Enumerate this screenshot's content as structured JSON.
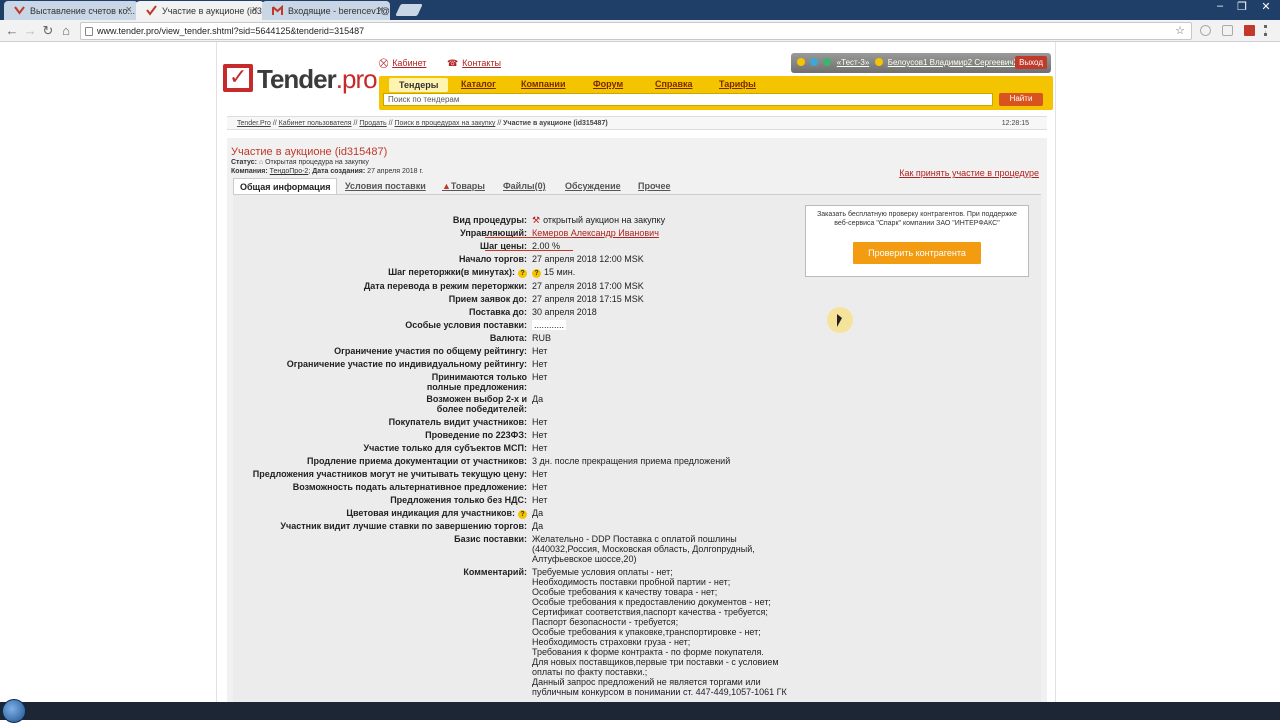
{
  "browser": {
    "tabs": [
      {
        "title": "Выставление счетов ко...",
        "close": "×",
        "favicon_color": "#c0392b"
      },
      {
        "title": "Участие в аукционе (id3...",
        "close": "×",
        "favicon_color": "#c0392b"
      },
      {
        "title": "Входящие - berencev1@...",
        "close": "×",
        "favicon_color": "#c0392b"
      }
    ],
    "window_controls": [
      "–",
      "❐",
      "✕"
    ],
    "url": "www.tender.pro/view_tender.shtml?sid=5644125&tenderid=315487",
    "nav": {
      "back": "←",
      "forward": "→",
      "reload": "↻",
      "home": "⌂",
      "star": "☆"
    }
  },
  "header": {
    "logo_main": "Tender",
    "logo_suffix": ".pro",
    "links": [
      {
        "icon": "cart-icon",
        "label": "Кабинет"
      },
      {
        "icon": "phone-icon",
        "label": "Контакты"
      }
    ],
    "user": {
      "company": "«Тест-3»",
      "name": "Белоусов1 Владимир2 Сергеевич2",
      "logout": "Выход"
    },
    "nav_tabs": [
      "Тендеры",
      "Каталог",
      "Компании",
      "Форум",
      "Справка",
      "Тарифы"
    ],
    "search_placeholder": "Поиск по тендерам",
    "search_button": "Найти"
  },
  "breadcrumb": {
    "items": [
      "Tender.Pro",
      "Кабинет пользователя",
      "Продать",
      "Поиск в процедурах на закупку"
    ],
    "separator": "//",
    "current": "Участие в аукционе (id315487)",
    "time": "12:28:15"
  },
  "procedure": {
    "title": "Участие в аукционе (id315487)",
    "status_label": "Статус:",
    "status_value": "Открытая процедура на закупку",
    "company_label": "Компания:",
    "company_value": "ТендоПро-2",
    "created_label": "Дата создания:",
    "created_value": "27 апреля 2018 г.",
    "howto_link": "Как принять участие в процедуре"
  },
  "tabs": [
    "Общая информация",
    "Условия поставки",
    "Товары",
    "Файлы(0)",
    "Обсуждение",
    "Прочее"
  ],
  "details": [
    {
      "label": "Вид процедуры:",
      "value": "открытый аукцион на закупку"
    },
    {
      "label": "Управляющий:",
      "value": "Кемеров Александр Иванович"
    },
    {
      "label": "Шаг цены:",
      "value": "2.00 %"
    },
    {
      "label": "Начало торгов:",
      "value": "27 апреля 2018 12:00 MSK"
    },
    {
      "label": "Шаг переторжки(в минутах):",
      "value": "15 мин."
    },
    {
      "label": "Дата перевода в режим переторжки:",
      "value": "27 апреля 2018 17:00 MSK"
    },
    {
      "label": "Прием заявок до:",
      "value": "27 апреля 2018 17:15 MSK"
    },
    {
      "label": "Поставка до:",
      "value": "30 апреля 2018"
    },
    {
      "label": "Особые условия поставки:",
      "value": "............"
    },
    {
      "label": "Валюта:",
      "value": "RUB"
    },
    {
      "label": "Ограничение участия по общему рейтингу:",
      "value": "Нет"
    },
    {
      "label": "Ограничение участие по индивидуальному рейтингу:",
      "value": "Нет"
    },
    {
      "label": "Принимаются только полные предложения:",
      "value": "Нет"
    },
    {
      "label": "Возможен выбор 2-х и более победителей:",
      "value": "Да"
    },
    {
      "label": "Покупатель видит участников:",
      "value": "Нет"
    },
    {
      "label": "Проведение по 223ФЗ:",
      "value": "Нет"
    },
    {
      "label": "Участие только для субъектов МСП:",
      "value": "Нет"
    },
    {
      "label": "Продление приема документации от участников:",
      "value": "3 дн. после прекращения приема предложений"
    },
    {
      "label": "Предложения участников могут не учитывать текущую цену:",
      "value": "Нет"
    },
    {
      "label": "Возможность подать альтернативное предложение:",
      "value": "Нет"
    },
    {
      "label": "Предложения только без НДС:",
      "value": "Нет"
    },
    {
      "label": "Цветовая индикация для участников:",
      "value": "Да"
    },
    {
      "label": "Участник видит лучшие ставки по завершению торгов:",
      "value": "Да"
    },
    {
      "label": "Базис поставки:",
      "value": [
        "Желательно - DDP Поставка с оплатой пошлины",
        "(440032,Россия, Московская область, Долгопрудный,",
        "Алтуфьевское шоссе,20)"
      ]
    },
    {
      "label": "Комментарий:",
      "value": [
        "Требуемые условия оплаты - нет;",
        "Необходимость поставки пробной партии - нет;",
        "Особые требования к качеству товара - нет;",
        "Особые требования к предоставлению документов - нет;",
        "Сертификат соответствия,паспорт качества - требуется;",
        "Паспорт безопасности - требуется;",
        "Особые требования к упаковке,транспортировке - нет;",
        "Необходимость страховки груза - нет;",
        "Требования к форме контракта - по форме покупателя.",
        "Для новых поставщиков,первые три поставки - с условием",
        "оплаты по факту поставки.;",
        "Данный запрос предложений не является торгами или",
        "публичным конкурсом в понимании ст. 447-449,1057-1061 ГК"
      ]
    }
  ],
  "help_mark": "?",
  "sidebox": {
    "text": "Заказать бесплатную проверку контрагентов. При поддержке веб-сервиса \"Спарк\" компании ЗАО \"ИНТЕРФАКС\"",
    "button": "Проверить контрагента"
  }
}
